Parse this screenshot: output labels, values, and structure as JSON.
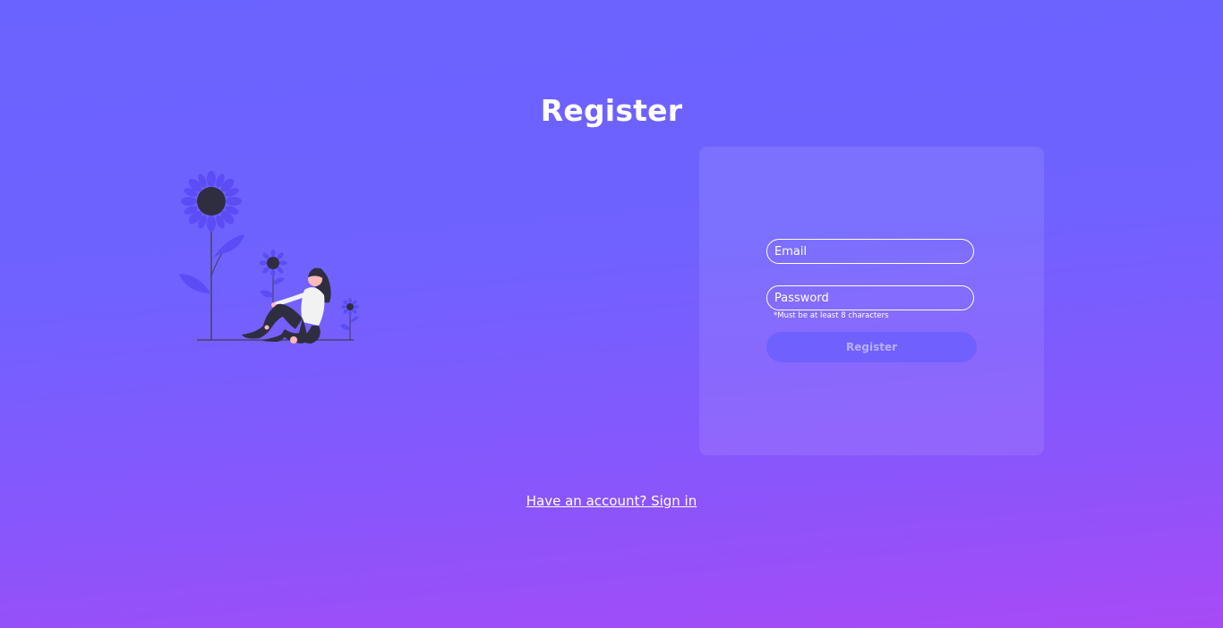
{
  "page": {
    "title": "Register"
  },
  "form": {
    "email": {
      "value": "",
      "placeholder": "Email"
    },
    "password": {
      "value": "",
      "placeholder": "Password",
      "hint": "*Must be at least 8 characters"
    },
    "submit_label": "Register"
  },
  "footer": {
    "signin_link": "Have an account? Sign in"
  },
  "illustration": {
    "icon": "woman-sitting-with-sunflowers-illustration"
  },
  "colors": {
    "background_top": "#6b63ff",
    "background_bottom": "#a84af6",
    "flower": "#5b4cf5",
    "flower_center": "#2f2e41",
    "text": "#ffffff"
  }
}
